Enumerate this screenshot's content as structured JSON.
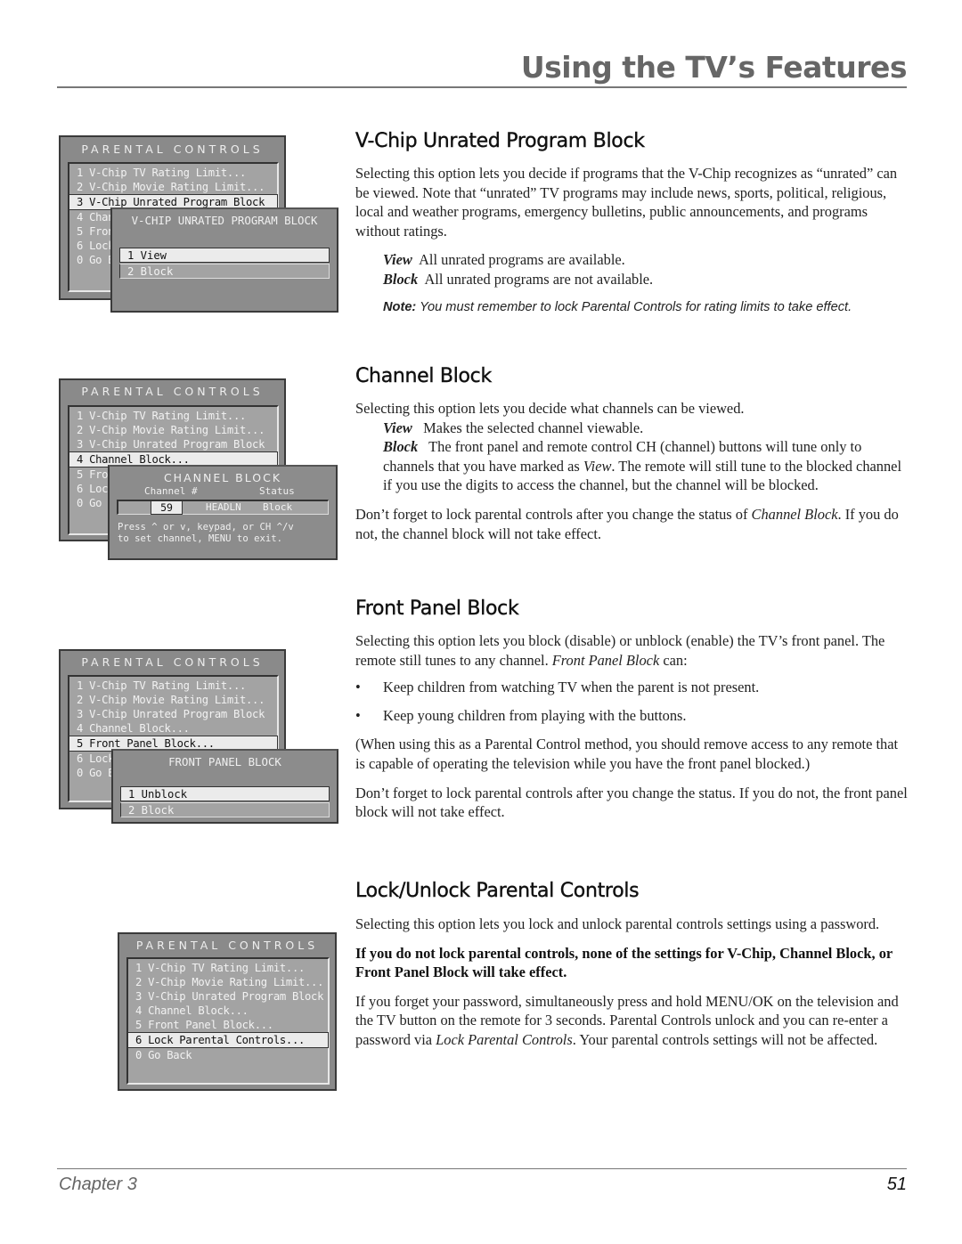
{
  "header": {
    "title": "Using the TV’s Features"
  },
  "footer": {
    "chapter": "Chapter 3",
    "page_number": "51"
  },
  "screens": {
    "parental_title": "PARENTAL CONTROLS",
    "menu_items": [
      "1 V-Chip TV Rating Limit...",
      "2 V-Chip Movie Rating Limit...",
      "3 V-Chip Unrated Program Block",
      "4 Channel Block...",
      "5 Front Panel Block...",
      "6 Lock Parental Controls...",
      "0 Go Back"
    ],
    "vchip_popup": {
      "title": "V-CHIP UNRATED PROGRAM BLOCK",
      "options": [
        "1 View",
        "2 Block"
      ],
      "selected": "1 View"
    },
    "channel_popup": {
      "title": "CHANNEL BLOCK",
      "col_channel": "Channel #",
      "col_status": "Status",
      "channel": "59",
      "station": "HEADLN",
      "status": "Block",
      "help_line1": "Press ^ or v, keypad, or CH ^/v",
      "help_line2": "to set channel, MENU to exit."
    },
    "front_popup": {
      "title": "FRONT PANEL BLOCK",
      "options": [
        "1 Unblock",
        "2 Block"
      ],
      "selected": "1 Unblock"
    }
  },
  "sections": {
    "vchip": {
      "heading": "V-Chip Unrated Program Block",
      "intro": "Selecting this option lets you decide if programs that the V-Chip recognizes as “unrated” can be viewed. Note that “unrated” TV  programs may include news, sports, political, religious, local and weather programs, emergency bulletins, public announcements, and programs without ratings.",
      "view_term": "View",
      "view_desc": "All unrated programs are available.",
      "block_term": "Block",
      "block_desc": "All unrated programs are not available.",
      "note_label": "Note:",
      "note_text": "You must remember to lock Parental Controls for rating limits to take effect."
    },
    "channel": {
      "heading": "Channel Block",
      "intro": "Selecting this option lets you decide what channels can be viewed.",
      "view_term": "View",
      "view_desc": "Makes the selected channel viewable.",
      "block_term": "Block",
      "block_desc_a": "The front panel and remote control CH (channel) buttons will tune only to channels that you have marked as ",
      "block_desc_em": "View",
      "block_desc_b": ". The remote will still tune to the blocked channel if you use the digits to access the channel, but the channel will be blocked.",
      "reminder_a": "Don’t forget to lock parental controls after you change the status of ",
      "reminder_em": "Channel Block",
      "reminder_b": ". If you do not, the channel block will not take effect."
    },
    "front": {
      "heading": "Front Panel Block",
      "intro_a": "Selecting this option lets you block (disable) or unblock (enable) the TV’s front panel. The remote still tunes to any channel. ",
      "intro_em": "Front Panel Block",
      "intro_b": " can:",
      "bullets": [
        "Keep children from watching TV when the parent is not present.",
        "Keep young children from playing with the buttons."
      ],
      "bullet_char": "•",
      "paren": "(When using this as a Parental Control method, you should remove access to any remote that is capable of operating the television while you have the front panel blocked.)",
      "reminder": "Don’t forget to lock parental controls after you change the status. If you do not, the front panel block will not take effect."
    },
    "lock": {
      "heading": "Lock/Unlock Parental Controls",
      "intro": "Selecting this option lets you lock and unlock parental controls settings using a password.",
      "warning": "If you do not lock parental controls, none of the settings for V-Chip, Channel Block, or Front Panel Block will take effect.",
      "forgot_a": "If you forget your password, simultaneously press and hold MENU/OK on the television and the TV button on the remote for 3 seconds. Parental Controls unlock and you can re-enter a password via ",
      "forgot_em": "Lock Parental Controls",
      "forgot_b": ". Your parental controls settings will not be affected."
    }
  }
}
